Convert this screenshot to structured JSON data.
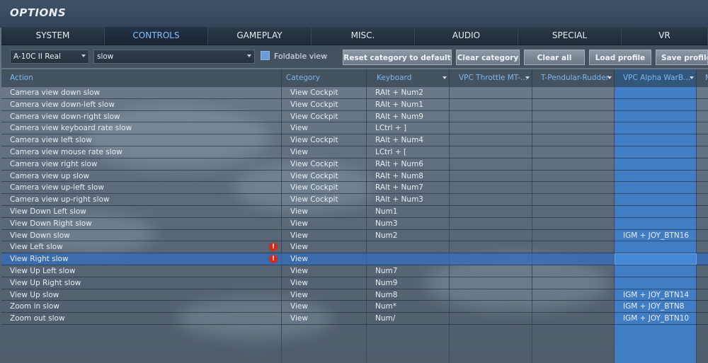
{
  "header": {
    "title": "OPTIONS"
  },
  "tabs": [
    {
      "label": "SYSTEM"
    },
    {
      "label": "CONTROLS"
    },
    {
      "label": "GAMEPLAY"
    },
    {
      "label": "MISC."
    },
    {
      "label": "AUDIO"
    },
    {
      "label": "SPECIAL"
    },
    {
      "label": "VR"
    }
  ],
  "active_tab": "CONTROLS",
  "toolbar": {
    "aircraft_select": "A-10C II Real",
    "filter_select": "slow",
    "foldable_label": "Foldable view",
    "foldable_checked": true,
    "reset_label": "Reset category to default",
    "clear_category_label": "Clear category",
    "clear_all_label": "Clear all",
    "load_profile_label": "Load profile",
    "save_profile_label": "Save profile a"
  },
  "columns": {
    "action": "Action",
    "category": "Category",
    "keyboard": "Keyboard",
    "throttle": "VPC Throttle MT-...",
    "rudder": "T-Pendular-Rudder",
    "warbrd": "VPC Alpha WarB...",
    "extra": "M"
  },
  "rows": [
    {
      "action": "Camera view down slow",
      "category": "View Cockpit",
      "keyboard": "RAlt + Num2",
      "warbrd": ""
    },
    {
      "action": "Camera view down-left slow",
      "category": "View Cockpit",
      "keyboard": "RAlt + Num1",
      "warbrd": ""
    },
    {
      "action": "Camera view down-right slow",
      "category": "View Cockpit",
      "keyboard": "RAlt + Num9",
      "warbrd": ""
    },
    {
      "action": "Camera view keyboard rate slow",
      "category": "View",
      "keyboard": "LCtrl + ]",
      "warbrd": ""
    },
    {
      "action": "Camera view left slow",
      "category": "View Cockpit",
      "keyboard": "RAlt + Num4",
      "warbrd": ""
    },
    {
      "action": "Camera view mouse rate slow",
      "category": "View",
      "keyboard": "LCtrl + [",
      "warbrd": ""
    },
    {
      "action": "Camera view right slow",
      "category": "View Cockpit",
      "keyboard": "RAlt + Num6",
      "warbrd": ""
    },
    {
      "action": "Camera view up slow",
      "category": "View Cockpit",
      "keyboard": "RAlt + Num8",
      "warbrd": ""
    },
    {
      "action": "Camera view up-left slow",
      "category": "View Cockpit",
      "keyboard": "RAlt + Num7",
      "warbrd": ""
    },
    {
      "action": "Camera view up-right slow",
      "category": "View Cockpit",
      "keyboard": "RAlt + Num3",
      "warbrd": ""
    },
    {
      "action": "View Down Left slow",
      "category": "View",
      "keyboard": "Num1",
      "warbrd": ""
    },
    {
      "action": "View Down Right slow",
      "category": "View",
      "keyboard": "Num3",
      "warbrd": ""
    },
    {
      "action": "View Down slow",
      "category": "View",
      "keyboard": "Num2",
      "warbrd": "IGM + JOY_BTN16"
    },
    {
      "action": "View Left slow",
      "category": "View",
      "keyboard": "",
      "warbrd": "",
      "warning": true
    },
    {
      "action": "View Right slow",
      "category": "View",
      "keyboard": "",
      "warbrd": "",
      "warning": true,
      "selected": true
    },
    {
      "action": "View Up Left slow",
      "category": "View",
      "keyboard": "Num7",
      "warbrd": ""
    },
    {
      "action": "View Up Right slow",
      "category": "View",
      "keyboard": "Num9",
      "warbrd": ""
    },
    {
      "action": "View Up slow",
      "category": "View",
      "keyboard": "Num8",
      "warbrd": "IGM + JOY_BTN14"
    },
    {
      "action": "Zoom in slow",
      "category": "View",
      "keyboard": "Num*",
      "warbrd": "IGM + JOY_BTN8"
    },
    {
      "action": "Zoom out slow",
      "category": "View",
      "keyboard": "Num/",
      "warbrd": "IGM + JOY_BTN10"
    }
  ],
  "warning_symbol": "!"
}
